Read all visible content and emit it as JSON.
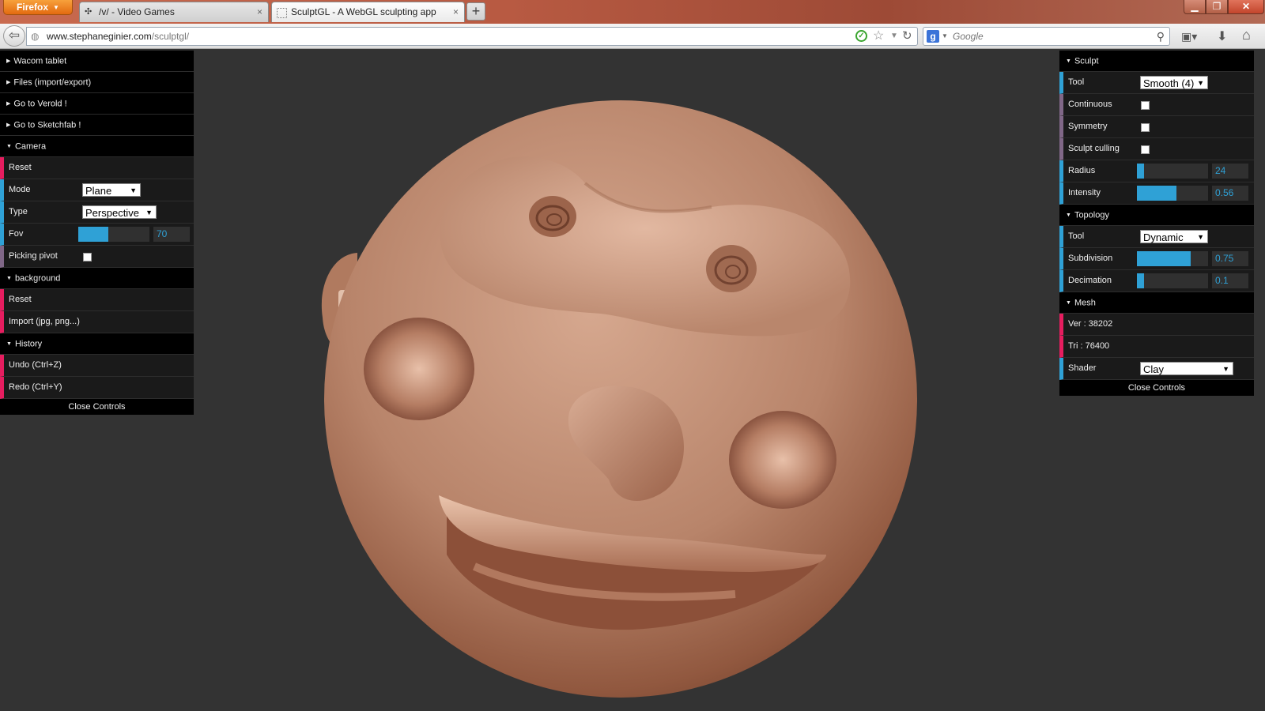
{
  "browser": {
    "menu_label": "Firefox",
    "tabs": [
      {
        "title": "/v/ - Video Games",
        "icon": "4chan-icon"
      },
      {
        "title": "SculptGL - A WebGL sculpting app",
        "icon": "page-icon"
      }
    ],
    "url_domain": "www.stephaneginier.com",
    "url_path": "/sculptgl/",
    "search_placeholder": "Google"
  },
  "left_panel": {
    "wacom": "Wacom tablet",
    "files": "Files (import/export)",
    "verold": "Go to Verold !",
    "sketchfab": "Go to Sketchfab !",
    "camera": {
      "title": "Camera",
      "reset": "Reset",
      "mode_label": "Mode",
      "mode_value": "Plane",
      "type_label": "Type",
      "type_value": "Perspective",
      "fov_label": "Fov",
      "fov_value": "70",
      "fov_fraction": 0.42,
      "picking_label": "Picking pivot"
    },
    "background": {
      "title": "background",
      "reset": "Reset",
      "import": "Import (jpg, png...)"
    },
    "history": {
      "title": "History",
      "undo": "Undo (Ctrl+Z)",
      "redo": "Redo (Ctrl+Y)"
    },
    "close": "Close Controls"
  },
  "right_panel": {
    "sculpt": {
      "title": "Sculpt",
      "tool_label": "Tool",
      "tool_value": "Smooth (4)",
      "continuous_label": "Continuous",
      "symmetry_label": "Symmetry",
      "culling_label": "Sculpt culling",
      "radius_label": "Radius",
      "radius_value": "24",
      "radius_fraction": 0.1,
      "intensity_label": "Intensity",
      "intensity_value": "0.56",
      "intensity_fraction": 0.56
    },
    "topology": {
      "title": "Topology",
      "tool_label": "Tool",
      "tool_value": "Dynamic",
      "subdivision_label": "Subdivision",
      "subdivision_value": "0.75",
      "subdivision_fraction": 0.75,
      "decimation_label": "Decimation",
      "decimation_value": "0.1",
      "decimation_fraction": 0.1
    },
    "mesh": {
      "title": "Mesh",
      "vertices": "Ver : 38202",
      "triangles": "Tri : 76400",
      "shader_label": "Shader",
      "shader_value": "Clay"
    },
    "close": "Close Controls"
  },
  "colors": {
    "accent": "#2fa1d6",
    "function_row": "#e61d5f",
    "boolean_row": "#806787",
    "clay": "#b07a5f"
  }
}
